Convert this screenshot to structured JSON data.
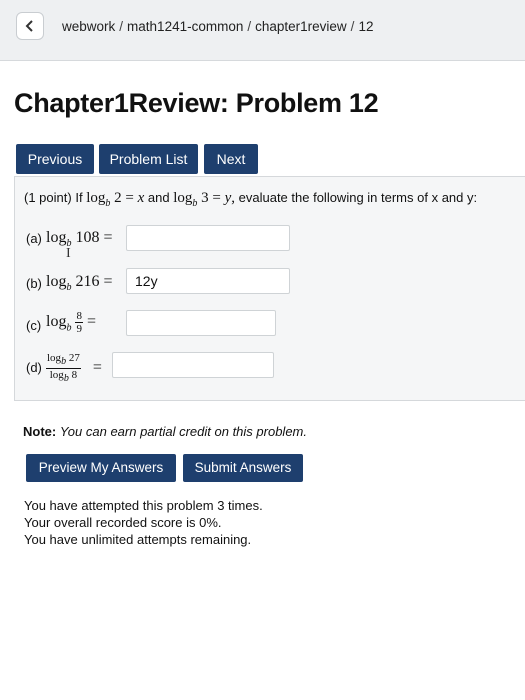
{
  "breadcrumb": [
    "webwork",
    "math1241-common",
    "chapter1review",
    "12"
  ],
  "page_title": "Chapter1Review: Problem 12",
  "nav": {
    "previous": "Previous",
    "problem_list": "Problem List",
    "next": "Next"
  },
  "problem": {
    "points": "(1 point)",
    "intro_if": "If",
    "intro_and": "and",
    "intro_tail": "evaluate the following in terms of x and y:",
    "given1": {
      "log": "log",
      "base": "b",
      "arg": "2",
      "rhs": "x"
    },
    "given2": {
      "log": "log",
      "base": "b",
      "arg": "3",
      "rhs": "y"
    },
    "parts": [
      {
        "label": "(a)",
        "log": "log",
        "base": "b",
        "arg": "108",
        "answer": ""
      },
      {
        "label": "(b)",
        "log": "log",
        "base": "b",
        "arg": "216",
        "answer": "12y"
      },
      {
        "label": "(c)",
        "log": "log",
        "base": "b",
        "arg_num": "8",
        "arg_den": "9",
        "answer": ""
      },
      {
        "label": "(d)",
        "num": "log",
        "num_base": "b",
        "num_arg": "27",
        "den": "log",
        "den_base": "b",
        "den_arg": "8",
        "answer": ""
      }
    ],
    "equals": "="
  },
  "note": {
    "label": "Note:",
    "text": "You can earn partial credit on this problem."
  },
  "actions": {
    "preview": "Preview My Answers",
    "submit": "Submit Answers"
  },
  "status": [
    "You have attempted this problem 3 times.",
    "Your overall recorded score is 0%.",
    "You have unlimited attempts remaining."
  ]
}
